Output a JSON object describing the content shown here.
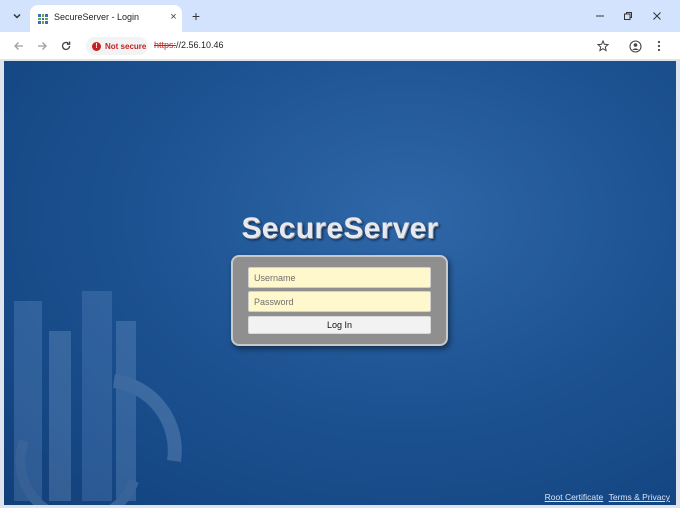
{
  "browser": {
    "tab": {
      "title": "SecureServer - Login",
      "close_glyph": "×"
    },
    "new_tab_glyph": "+",
    "address_bar": {
      "security_label": "Not secure",
      "url_scheme": "https:",
      "url_rest": "//2.56.10.46"
    },
    "icons": [
      "tab-search-icon",
      "favicon-icon",
      "close-icon",
      "plus-icon",
      "minimize-icon",
      "restore-icon",
      "close-window-icon",
      "back-arrow-icon",
      "forward-arrow-icon",
      "reload-icon",
      "warning-icon",
      "bookmark-star-icon",
      "profile-icon",
      "kebab-menu-icon"
    ]
  },
  "page": {
    "brand": "SecureServer",
    "login": {
      "username_placeholder": "Username",
      "password_placeholder": "Password",
      "submit_label": "Log In"
    },
    "footer": {
      "root_certificate": "Root Certificate",
      "terms_privacy": "Terms & Privacy"
    }
  },
  "colors": {
    "page_background": "#1d5392",
    "login_panel": "#8f8f8f",
    "input_fill": "#fff8cc",
    "not_secure_red": "#c5221f"
  }
}
